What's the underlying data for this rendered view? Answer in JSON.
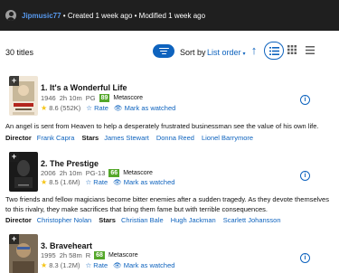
{
  "header": {
    "username": "Jipmusic77",
    "created": " • Created 1 week ago",
    "modified": " • Modified 1 week ago"
  },
  "toolbar": {
    "count": "30 titles",
    "sort_label": "Sort by",
    "sort_value": "List order",
    "caret": "▾",
    "arrow": "↑"
  },
  "items": [
    {
      "title": "1. It's a Wonderful Life",
      "year": "1946",
      "runtime": "2h 10m",
      "cert": "PG",
      "metascore": "89",
      "metascore_label": "Metascore",
      "rating": "8.6 (552K)",
      "rate": "Rate",
      "watched": "Mark as watched",
      "description": "An angel is sent from Heaven to help a desperately frustrated businessman see the value of his own life.",
      "director_label": "Director",
      "director": "Frank Capra",
      "stars_label": "Stars",
      "stars": [
        "James Stewart",
        "Donna Reed",
        "Lionel Barrymore"
      ]
    },
    {
      "title": "2. The Prestige",
      "year": "2006",
      "runtime": "2h 10m",
      "cert": "PG-13",
      "metascore": "66",
      "metascore_label": "Metascore",
      "rating": "8.5 (1.6M)",
      "rate": "Rate",
      "watched": "Mark as watched",
      "description": "Two friends and fellow magicians become bitter enemies after a sudden tragedy. As they devote themselves to this rivalry, they make sacrifices that bring them fame but with terrible consequences.",
      "director_label": "Director",
      "director": "Christopher Nolan",
      "stars_label": "Stars",
      "stars": [
        "Christian Bale",
        "Hugh Jackman",
        "Scarlett Johansson"
      ]
    },
    {
      "title": "3. Braveheart",
      "year": "1995",
      "runtime": "2h 58m",
      "cert": "R",
      "metascore": "68",
      "metascore_label": "Metascore",
      "rating": "8.3 (1.2M)",
      "rate": "Rate",
      "watched": "Mark as watched"
    }
  ],
  "colors": {
    "accent": "#0e63be",
    "link": "#5799ef",
    "metascore": "#54a72a",
    "star": "#f5c518",
    "topbar": "#1f1f1f"
  }
}
